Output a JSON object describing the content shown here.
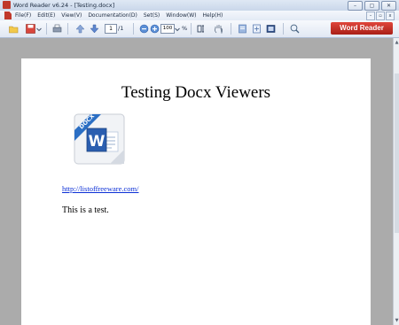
{
  "window": {
    "title": "Word Reader v6.24 - [Testing.docx]",
    "buttons": {
      "minimize": "–",
      "maximize": "▢",
      "close": "✕"
    }
  },
  "menubar": {
    "items": [
      "File(F)",
      "Edit(E)",
      "View(V)",
      "Documentation(D)",
      "Set(S)",
      "Window(W)",
      "Help(H)"
    ],
    "mdi": {
      "minimize": "–",
      "restore": "▫",
      "close": "x"
    }
  },
  "toolbar": {
    "page_input": "1",
    "page_total": "/1",
    "zoom_value": "100",
    "zoom_suffix": "%",
    "brand_label": "Word Reader",
    "icons": [
      "open-folder-icon",
      "save-icon",
      "print-icon",
      "up-arrow-icon",
      "down-arrow-icon",
      "zoom-out-icon",
      "zoom-in-icon",
      "text-select-icon",
      "hand-tool-icon",
      "single-page-icon",
      "fit-page-icon",
      "fullscreen-icon",
      "search-icon"
    ],
    "brand_color": "#c62a20"
  },
  "document": {
    "title": "Testing Docx Viewers",
    "image_label": "DOCX",
    "image_letter": "W",
    "link": "http://listoffreeware.com/",
    "body": "This is a test."
  }
}
